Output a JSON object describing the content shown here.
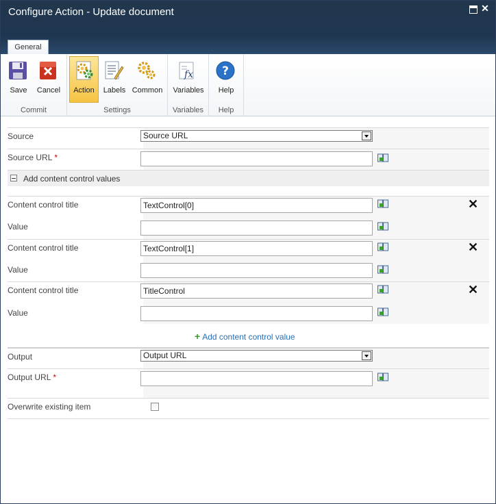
{
  "window": {
    "title": "Configure Action - Update document"
  },
  "ribbon": {
    "tabs": [
      "General"
    ],
    "groups": [
      {
        "label": "Commit",
        "buttons": [
          {
            "label": "Save",
            "icon": "save-icon"
          },
          {
            "label": "Cancel",
            "icon": "cancel-icon"
          }
        ]
      },
      {
        "label": "Settings",
        "buttons": [
          {
            "label": "Action",
            "icon": "action-gears-icon",
            "selected": true
          },
          {
            "label": "Labels",
            "icon": "labels-icon"
          },
          {
            "label": "Common",
            "icon": "common-gears-icon"
          }
        ]
      },
      {
        "label": "Variables",
        "buttons": [
          {
            "label": "Variables",
            "icon": "variables-fx-icon"
          }
        ]
      },
      {
        "label": "Help",
        "buttons": [
          {
            "label": "Help",
            "icon": "help-icon"
          }
        ]
      }
    ]
  },
  "form": {
    "source_label": "Source",
    "source_value": "Source URL",
    "source_url_label": "Source URL",
    "required_mark": "*",
    "section_label": "Add content control values",
    "controls": [
      {
        "title_label": "Content control title",
        "title_value": "TextControl[0]",
        "value_label": "Value",
        "value_value": ""
      },
      {
        "title_label": "Content control title",
        "title_value": "TextControl[1]",
        "value_label": "Value",
        "value_value": ""
      },
      {
        "title_label": "Content control title",
        "title_value": "TitleControl",
        "value_label": "Value",
        "value_value": ""
      }
    ],
    "add_link": "Add content control value",
    "output_label": "Output",
    "output_value": "Output URL",
    "output_url_label": "Output URL",
    "overwrite_label": "Overwrite existing item"
  }
}
